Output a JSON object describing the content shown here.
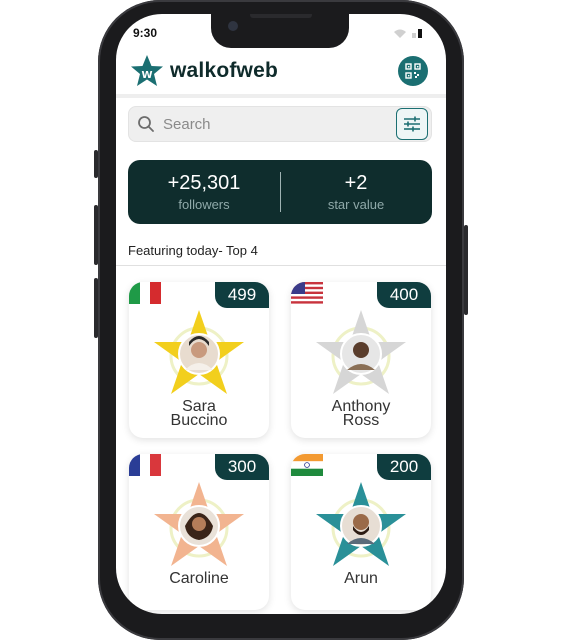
{
  "status_bar": {
    "time": "9:30"
  },
  "header": {
    "brand": "walkofweb"
  },
  "search": {
    "placeholder": "Search"
  },
  "stats": [
    {
      "value": "+25,301",
      "label": "followers"
    },
    {
      "value": "+2",
      "label": "star value"
    }
  ],
  "section": {
    "title": "Featuring today- Top 4"
  },
  "cards": [
    {
      "first": "Sara",
      "last": "Buccino",
      "score": "499",
      "country": "Italy",
      "star_color": "#f2cf1d"
    },
    {
      "first": "Anthony",
      "last": "Ross",
      "score": "400",
      "country": "USA",
      "star_color": "#d6d6d6"
    },
    {
      "first": "Caroline",
      "last": "",
      "score": "300",
      "country": "France",
      "star_color": "#f2b490"
    },
    {
      "first": "Arun",
      "last": "",
      "score": "200",
      "country": "India",
      "star_color": "#2a9098"
    }
  ],
  "colors": {
    "accent": "#1b6f72",
    "dark": "#0f2d2d",
    "score_bg": "#0f3d3f"
  }
}
